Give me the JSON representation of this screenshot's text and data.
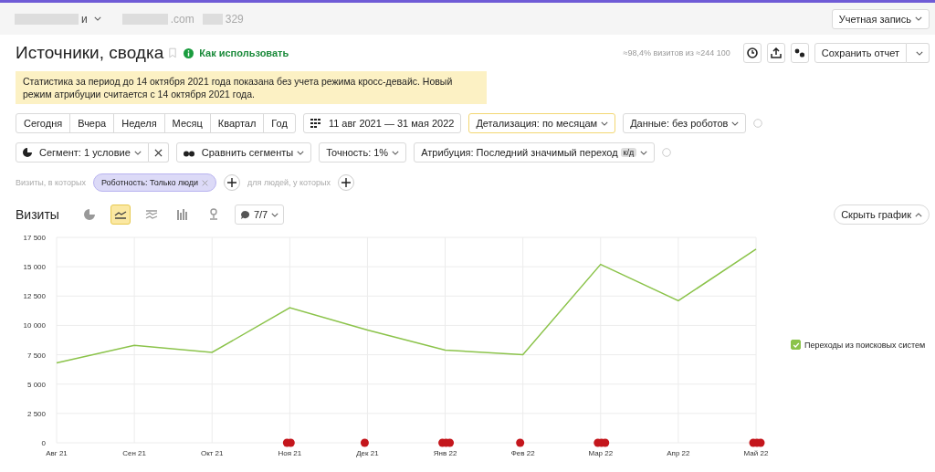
{
  "header": {
    "counter_name": "и",
    "site": ".com",
    "counter_id": "329",
    "account": "Учетная запись"
  },
  "title": "Источники, сводка",
  "help_link": "Как использовать",
  "sample_note": "≈98,4% визитов из ≈244 100",
  "save_button": "Сохранить отчет",
  "notice": "Статистика за период до 14 октября 2021 года показана без учета режима кросс-девайс. Новый режим атрибуции считается с 14 октября 2021 года.",
  "periods": [
    {
      "label": "Сегодня",
      "selected": false
    },
    {
      "label": "Вчера",
      "selected": false
    },
    {
      "label": "Неделя",
      "selected": false
    },
    {
      "label": "Месяц",
      "selected": false
    },
    {
      "label": "Квартал",
      "selected": false
    },
    {
      "label": "Год",
      "selected": false
    }
  ],
  "date_range": "11 авг 2021 — 31 мая 2022",
  "grouping": "Детализация: по месяцам",
  "data_filter": "Данные: без роботов",
  "segment": "Сегмент: 1 условие",
  "compare": "Сравнить сегменты",
  "accuracy": "Точность: 1%",
  "attribution": "Атрибуция: Последний значимый переход",
  "attribution_badge": "к/д",
  "filter_prefix": "Визиты, в которых",
  "filter_tag": "Роботность: Только люди",
  "filter_suffix": "для людей, у которых",
  "metric": "Визиты",
  "chart_types": [
    {
      "kind": "pie",
      "selected": false
    },
    {
      "kind": "line",
      "selected": true
    },
    {
      "kind": "area",
      "selected": false
    },
    {
      "kind": "bars",
      "selected": false
    },
    {
      "kind": "map",
      "selected": false
    }
  ],
  "series_count": "7/7",
  "hide_chart": "Скрыть график",
  "legend": [
    {
      "checked": true
    }
  ],
  "chart_data": {
    "type": "line",
    "grid": true,
    "categories": [
      "Авг 21",
      "Сен 21",
      "Окт 21",
      "Ноя 21",
      "Дек 21",
      "Янв 22",
      "Фев 22",
      "Мар 22",
      "Апр 22",
      "Май 22"
    ],
    "series": [
      {
        "name": "Переходы из поисковых систем",
        "color": "#8bc34a",
        "values": [
          6800,
          8300,
          7700,
          11500,
          9600,
          7900,
          7500,
          15200,
          12100,
          16500
        ]
      }
    ],
    "ylim": [
      0,
      17500
    ],
    "yticks": [
      {
        "value": 0,
        "label": "0"
      },
      {
        "value": 2500,
        "label": "2 500"
      },
      {
        "value": 5000,
        "label": "5 000"
      },
      {
        "value": 7500,
        "label": "7 500"
      },
      {
        "value": 10000,
        "label": "10 000"
      },
      {
        "value": 12500,
        "label": "12 500"
      },
      {
        "value": 15000,
        "label": "15 000"
      },
      {
        "value": 17500,
        "label": "17 500"
      }
    ]
  }
}
